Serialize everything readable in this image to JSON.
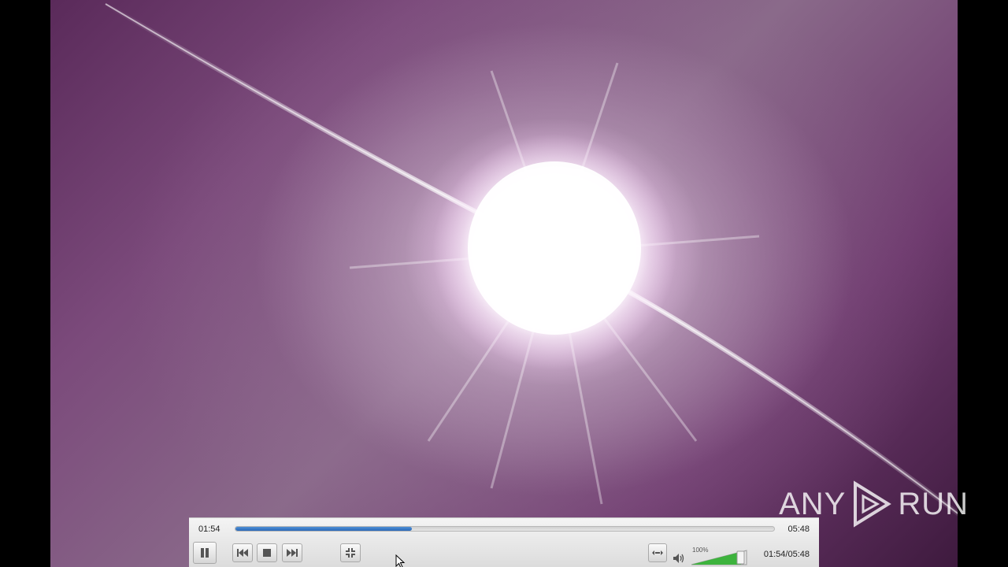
{
  "video": {
    "description_icon": "video-frame-icon"
  },
  "watermark": {
    "left_text": "ANY",
    "right_text": "RUN",
    "icon": "play-triangle-icon"
  },
  "controller": {
    "elapsed": "01:54",
    "total": "05:48",
    "progress_fraction": 0.3276,
    "time_combo": "01:54/05:48",
    "volume_label": "100%",
    "volume_fraction": 1.0,
    "buttons": {
      "pause": "pause-icon",
      "previous": "skip-previous-icon",
      "stop": "stop-icon",
      "next": "skip-next-icon",
      "fullscreen": "exit-fullscreen-icon",
      "extended": "extended-settings-icon",
      "volume": "speaker-icon"
    },
    "accent": "#2f73c4",
    "volume_color": "#3db33d"
  }
}
